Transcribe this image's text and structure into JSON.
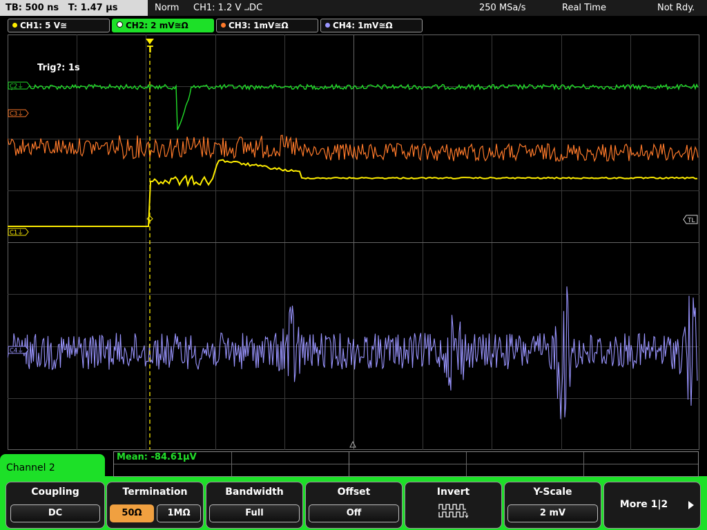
{
  "header": {
    "tb": "TB: 500 ns",
    "t": "T: 1.47 µs",
    "mode": "Norm",
    "trigger": "CH1: 1.2 V ⨼DC",
    "samplerate": "250 MSa/s",
    "acq": "Real Time",
    "status": "Not Rdy."
  },
  "channels": [
    {
      "label": "CH1: 5 V≅",
      "color": "#ffee00"
    },
    {
      "label": "CH2: 2 mV≅Ω",
      "color": "#22e02a"
    },
    {
      "label": "CH3: 1mV≅Ω",
      "color": "#ff7a2a"
    },
    {
      "label": "CH4: 1mV≅Ω",
      "color": "#9a95ff"
    }
  ],
  "scope": {
    "trig_info": "Trig?: 1s",
    "marker_c2": "C2⏚",
    "marker_c3": "C3⏚",
    "marker_c1": "C1⏚",
    "marker_c4": "C4⏚",
    "marker_tl": "TL"
  },
  "measurement": {
    "mean": "Mean: -84.61µV"
  },
  "panel": {
    "title": "Channel 2",
    "softkeys": [
      {
        "title": "Coupling",
        "values": [
          "DC"
        ]
      },
      {
        "title": "Termination",
        "values": [
          "50Ω",
          "1MΩ"
        ],
        "active": 0
      },
      {
        "title": "Bandwidth",
        "values": [
          "Full"
        ]
      },
      {
        "title": "Offset",
        "values": [
          "Off"
        ]
      },
      {
        "title": "Invert",
        "icon": "invert-waveform-icon"
      },
      {
        "title": "Y-Scale",
        "values": [
          "2 mV"
        ]
      },
      {
        "title": "More 1|2",
        "icon": "arrow-right-icon"
      }
    ]
  },
  "colors": {
    "ch1": "#ffee00",
    "ch2": "#22e02a",
    "ch3": "#ff7a2a",
    "ch4": "#9a95ff",
    "grid": "#555555",
    "trigger_marker": "#ffee00"
  }
}
